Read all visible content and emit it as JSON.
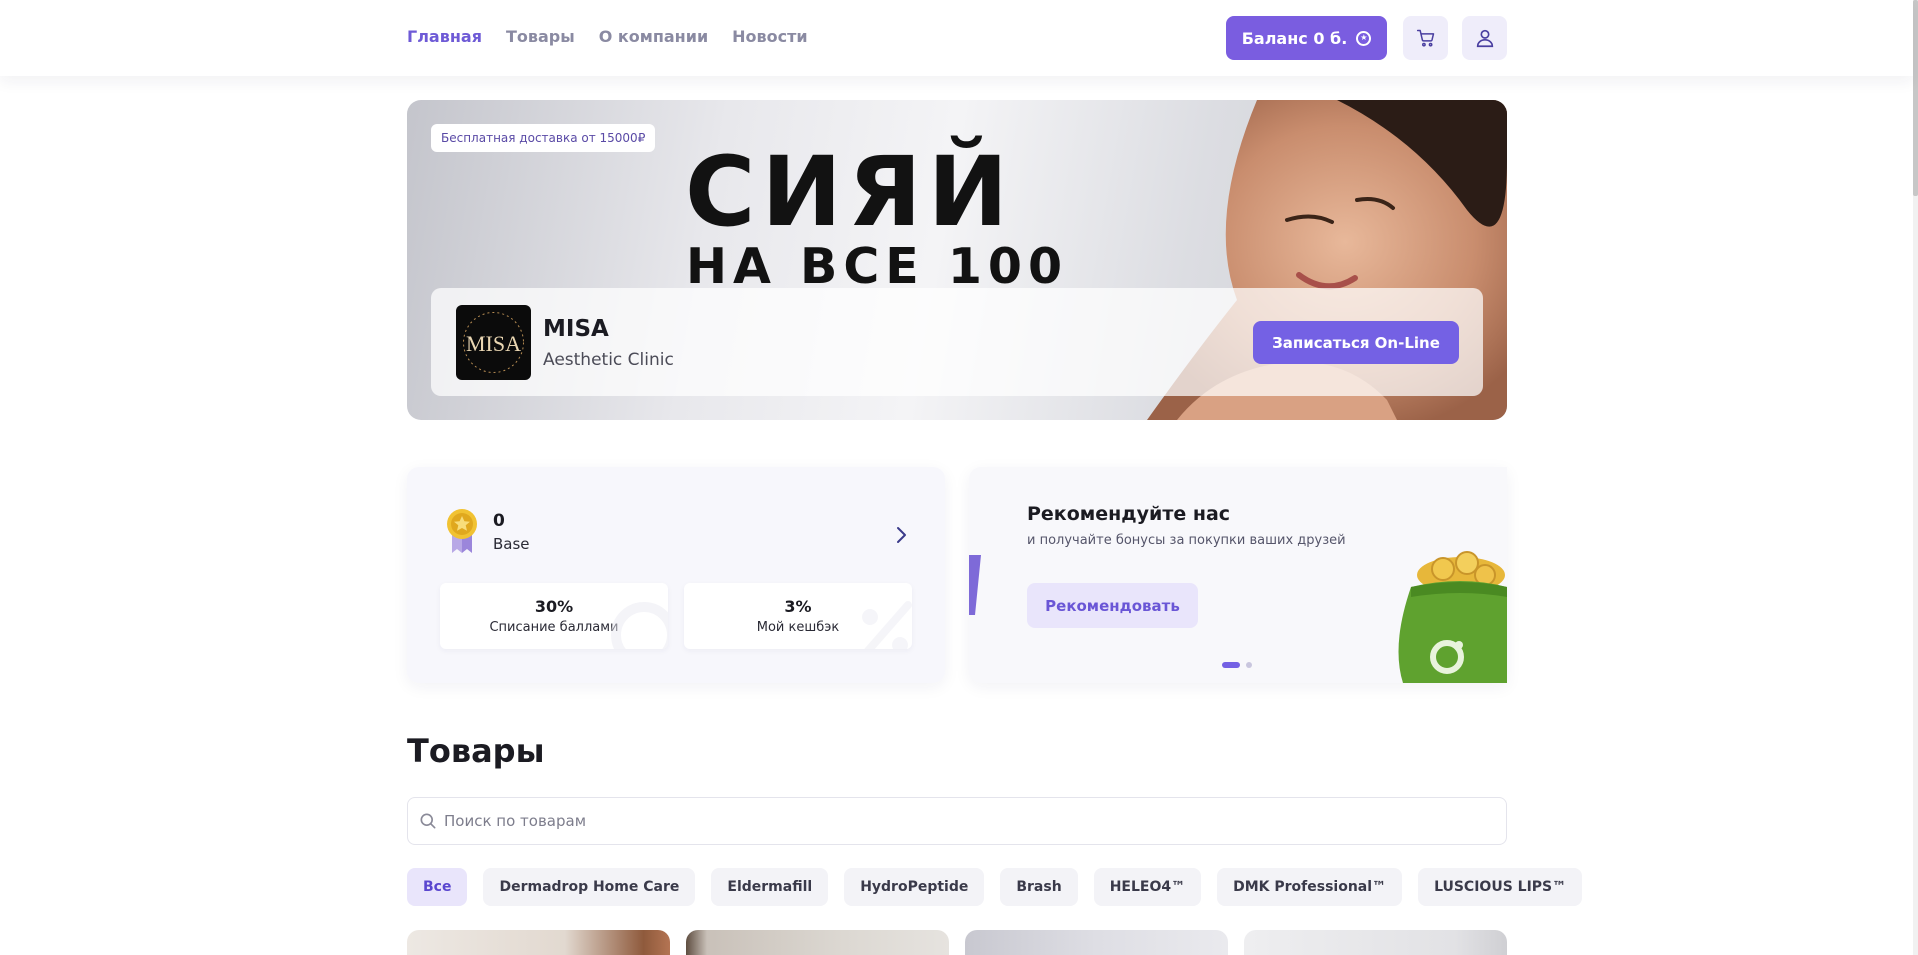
{
  "header": {
    "nav": [
      {
        "label": "Главная",
        "active": true
      },
      {
        "label": "Товары",
        "active": false
      },
      {
        "label": "О компании",
        "active": false
      },
      {
        "label": "Новости",
        "active": false
      }
    ],
    "balance_label": "Баланс 0 б.",
    "balance_icon": "coin-icon",
    "cart_icon": "cart-icon",
    "profile_icon": "user-icon",
    "accent_color": "#7a5de0"
  },
  "hero": {
    "delivery_badge": "Бесплатная доставка от 15000₽",
    "slogan_line1": "СИЯЙ",
    "slogan_line2": "НА ВСЕ 100",
    "clinic": {
      "logo_text": "MISA",
      "name": "MISA",
      "subtitle": "Aesthetic Clinic",
      "signup_label": "Записаться On-Line"
    }
  },
  "loyalty": {
    "points": "0",
    "level": "Base",
    "level_icon": "medal-icon",
    "stats": [
      {
        "value": "30%",
        "label": "Списание баллами"
      },
      {
        "value": "3%",
        "label": "Мой кешбэк"
      }
    ]
  },
  "referral": {
    "title": "Рекомендуйте нас",
    "subtitle": "и получайте бонусы за покупки ваших друзей",
    "button_label": "Рекомендовать",
    "slides_total": 2,
    "active_slide": 1
  },
  "products": {
    "title": "Товары",
    "search_placeholder": "Поиск по товарам",
    "search_value": "",
    "categories": [
      {
        "label": "Все",
        "active": true
      },
      {
        "label": "Dermadrop Home Care",
        "active": false
      },
      {
        "label": "Eldermafill",
        "active": false
      },
      {
        "label": "HydroPeptide",
        "active": false
      },
      {
        "label": "Brash",
        "active": false
      },
      {
        "label": "HELEO4™",
        "active": false
      },
      {
        "label": "DMK Professional™",
        "active": false
      },
      {
        "label": "LUSCIOUS LIPS™",
        "active": false
      }
    ]
  }
}
